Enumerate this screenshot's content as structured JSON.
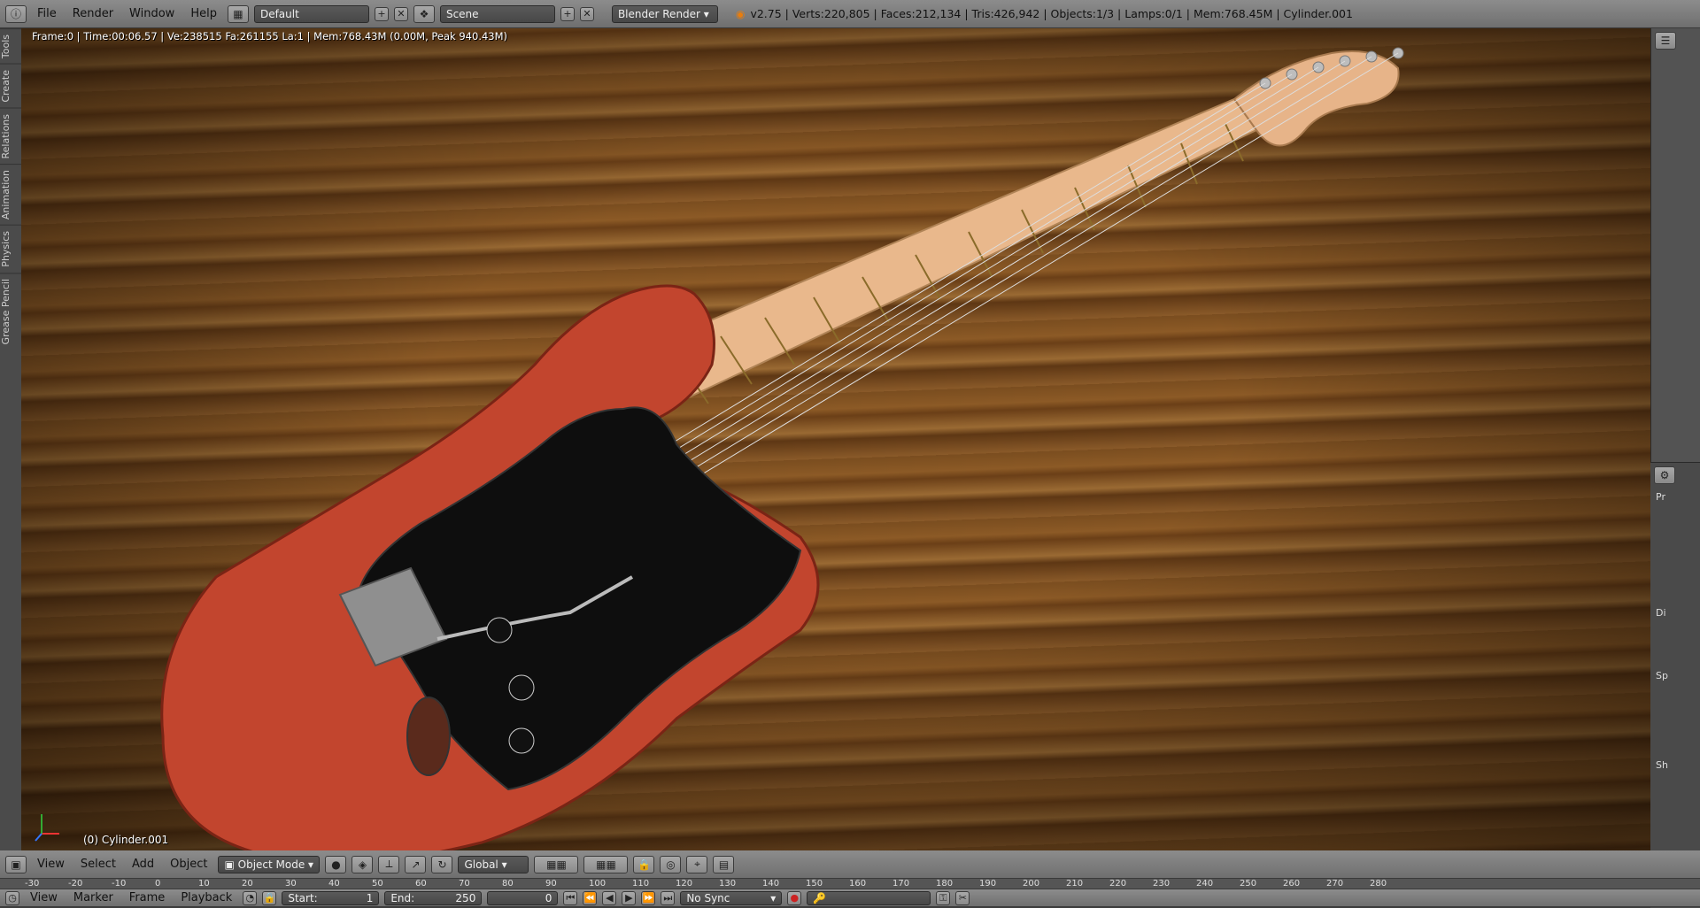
{
  "topbar": {
    "menus": [
      "File",
      "Render",
      "Window",
      "Help"
    ],
    "layout": "Default",
    "scene": "Scene",
    "engine": "Blender Render",
    "stats": "v2.75 | Verts:220,805 | Faces:212,134 | Tris:426,942 | Objects:1/3 | Lamps:0/1 | Mem:768.45M | Cylinder.001"
  },
  "left_tabs": [
    "Tools",
    "Create",
    "Relations",
    "Animation",
    "Physics",
    "Grease Pencil"
  ],
  "viewport": {
    "info": "Frame:0 | Time:00:06.57 | Ve:238515 Fa:261155 La:1 | Mem:768.43M (0.00M, Peak 940.43M)",
    "object_label": "(0) Cylinder.001"
  },
  "vp_header": {
    "menus": [
      "View",
      "Select",
      "Add",
      "Object"
    ],
    "mode": "Object Mode",
    "orientation": "Global"
  },
  "ruler": {
    "ticks": [
      "-30",
      "-20",
      "-10",
      "0",
      "10",
      "20",
      "30",
      "40",
      "50",
      "60",
      "70",
      "80",
      "90",
      "100",
      "110",
      "120",
      "130",
      "140",
      "150",
      "160",
      "170",
      "180",
      "190",
      "200",
      "210",
      "220",
      "230",
      "240",
      "250",
      "260",
      "270",
      "280"
    ]
  },
  "timeline": {
    "menus": [
      "View",
      "Marker",
      "Frame",
      "Playback"
    ],
    "start_label": "Start:",
    "start_value": "1",
    "end_label": "End:",
    "end_value": "250",
    "current": "0",
    "sync": "No Sync"
  },
  "props": {
    "labels": [
      "Pr",
      "Di",
      "Sp",
      "Sh"
    ]
  }
}
